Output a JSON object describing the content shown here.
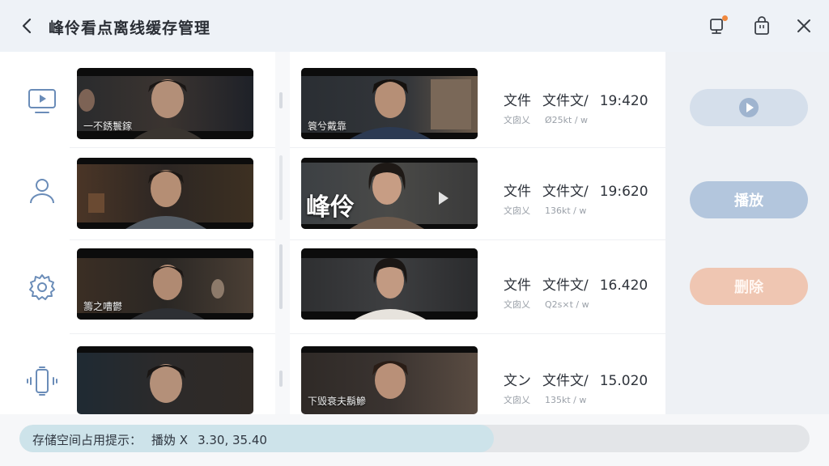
{
  "header": {
    "title": "峰伶看点离线缓存管理",
    "notification_dot_color": "#f0883e"
  },
  "nav": {
    "items": [
      {
        "icon": "tv-icon"
      },
      {
        "icon": "user-icon"
      },
      {
        "icon": "gear-icon"
      },
      {
        "icon": "device-vibrate-icon"
      }
    ]
  },
  "left_thumbs": [
    {
      "caption": "一不銹鬟鎵"
    },
    {
      "caption": ""
    },
    {
      "caption": "籌之嘈鬱"
    },
    {
      "caption": ""
    }
  ],
  "items": [
    {
      "caption": "簑兮戴靠",
      "big_caption": "",
      "line1_a": "文件",
      "line1_b": "文件文/",
      "line1_c": "19:420",
      "line2_a": "文囱乂",
      "line2_b": "Ø25kt / w"
    },
    {
      "caption": "",
      "big_caption": "峰伶",
      "line1_a": "文件",
      "line1_b": "文件文/",
      "line1_c": "19:620",
      "line2_a": "文囱乂",
      "line2_b": "136kt / w"
    },
    {
      "caption": "",
      "big_caption": "",
      "line1_a": "文件",
      "line1_b": "文件文/",
      "line1_c": "16.420",
      "line2_a": "文囱乂",
      "line2_b": "Q2s×t / w"
    },
    {
      "caption": "下毁衰夫鬍鰺",
      "big_caption": "",
      "line1_a": "文ン",
      "line1_b": "文件文/",
      "line1_c": "15.020",
      "line2_a": "文囱乂",
      "line2_b": "135kt / w"
    }
  ],
  "actions": {
    "play_label": "播放",
    "delete_label": "删除"
  },
  "storage": {
    "label": "存储空间占用提示：",
    "detail_a": "播妫 X",
    "detail_b": "3.30, 35.40",
    "fill_fraction": 0.6
  }
}
